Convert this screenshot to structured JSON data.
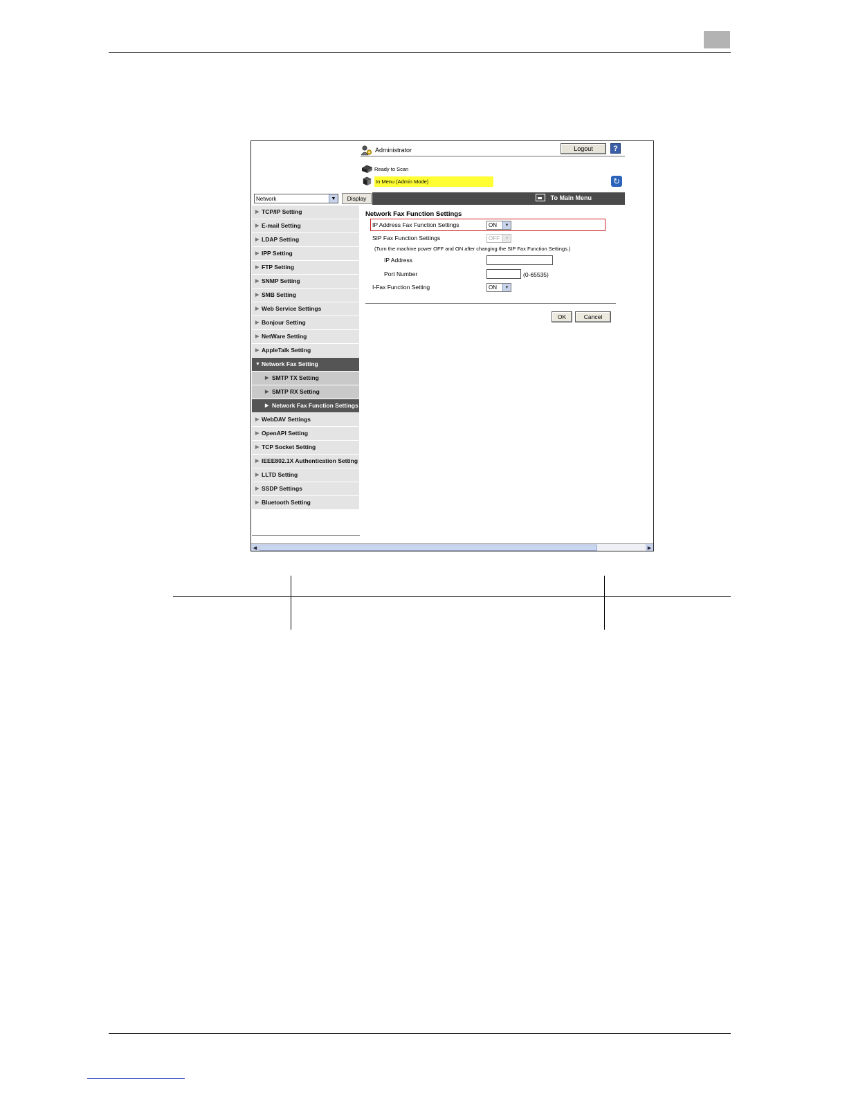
{
  "header": {
    "user_label": "Administrator",
    "logout_label": "Logout",
    "help_label": "?",
    "status_ready": "Ready to Scan",
    "status_mode": "In Menu (Admin Mode)"
  },
  "menubar": {
    "category_value": "Network",
    "display_label": "Display",
    "main_menu_label": "To Main Menu"
  },
  "sidebar": {
    "items": [
      {
        "label": "TCP/IP Setting"
      },
      {
        "label": "E-mail Setting"
      },
      {
        "label": "LDAP Setting"
      },
      {
        "label": "IPP Setting"
      },
      {
        "label": "FTP Setting"
      },
      {
        "label": "SNMP Setting"
      },
      {
        "label": "SMB Setting"
      },
      {
        "label": "Web Service Settings"
      },
      {
        "label": "Bonjour Setting"
      },
      {
        "label": "NetWare Setting"
      },
      {
        "label": "AppleTalk Setting"
      },
      {
        "label": "Network Fax Setting"
      },
      {
        "label": "SMTP TX Setting"
      },
      {
        "label": "SMTP RX Setting"
      },
      {
        "label": "Network Fax Function Settings"
      },
      {
        "label": "WebDAV Settings"
      },
      {
        "label": "OpenAPI Setting"
      },
      {
        "label": "TCP Socket Setting"
      },
      {
        "label": "IEEE802.1X Authentication Setting"
      },
      {
        "label": "LLTD Setting"
      },
      {
        "label": "SSDP Settings"
      },
      {
        "label": "Bluetooth Setting"
      }
    ]
  },
  "content": {
    "title": "Network Fax Function Settings",
    "ip_fax_label": "IP Address Fax Function Settings",
    "ip_fax_value": "ON",
    "sip_fax_label": "SIP Fax Function Settings",
    "sip_fax_value": "OFF",
    "sip_note": "(Turn the machine power OFF and ON after changing the SIP Fax Function Settings.)",
    "ip_address_label": "IP Address",
    "ip_address_value": "",
    "port_label": "Port Number",
    "port_value": "",
    "port_range": "(0-65535)",
    "ifax_label": "I-Fax Function Setting",
    "ifax_value": "ON",
    "ok_label": "OK",
    "cancel_label": "Cancel"
  },
  "colors": {
    "highlight_border": "#cc2222",
    "status_highlight": "#ffff33",
    "menubar_dark": "#4a4a4a"
  }
}
